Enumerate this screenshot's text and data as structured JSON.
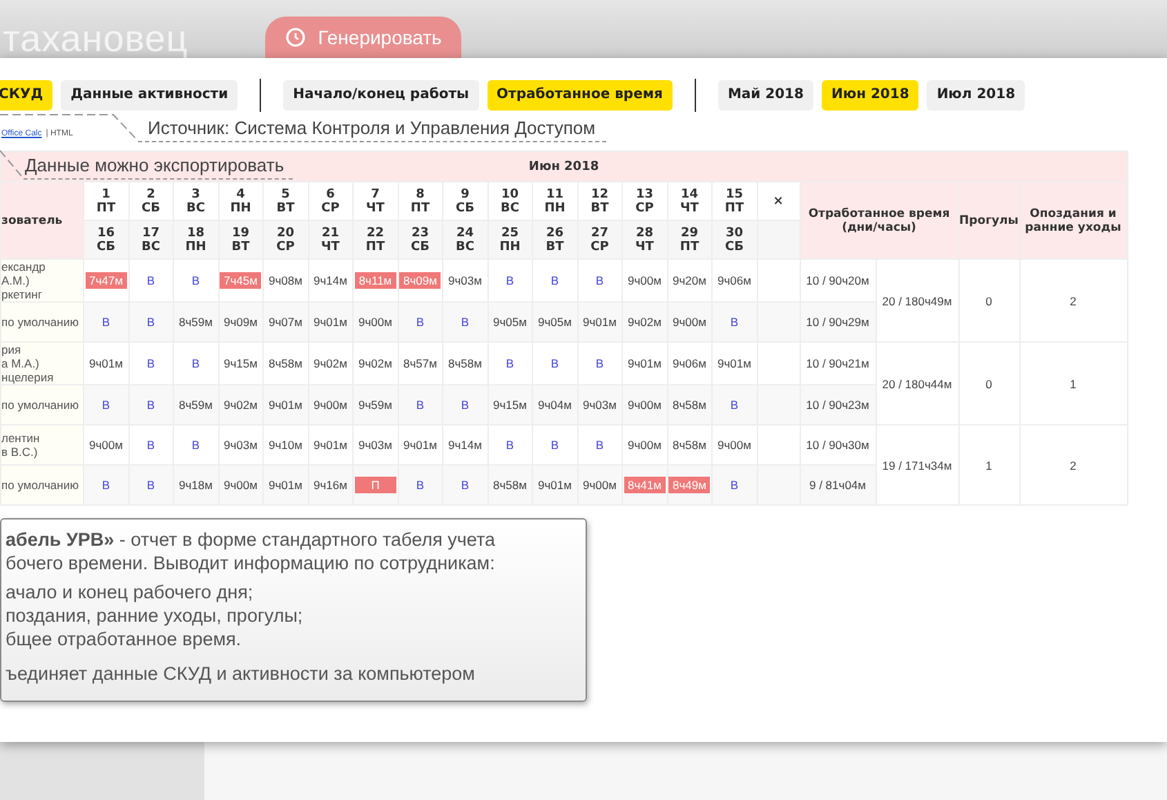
{
  "app_header": {
    "logo": "таханoвец",
    "generate_button": "Генерировать"
  },
  "toolbar": [
    [
      {
        "label": "СКУД",
        "selected": true
      },
      {
        "label": "Данные активности",
        "selected": false
      }
    ],
    [
      {
        "label": "Начало/конец работы",
        "selected": false
      },
      {
        "label": "Отработанное время",
        "selected": true
      }
    ],
    [
      {
        "label": "Май 2018",
        "selected": false
      },
      {
        "label": "Июн 2018",
        "selected": true
      },
      {
        "label": "Июл 2018",
        "selected": false
      }
    ]
  ],
  "export_links": [
    {
      "label": "Office Calc",
      "kind": "link"
    },
    {
      "label": "| HTML",
      "kind": "plain"
    }
  ],
  "annotations": [
    "Источник: Система Контроля и Управления Доступом",
    "Данные можно экспортировать"
  ],
  "table": {
    "month": "Июн 2018",
    "user_header": "зователь",
    "days_top": [
      {
        "day": "1",
        "weekday": "ПТ"
      },
      {
        "day": "2",
        "weekday": "СБ"
      },
      {
        "day": "3",
        "weekday": "ВС"
      },
      {
        "day": "4",
        "weekday": "ПН"
      },
      {
        "day": "5",
        "weekday": "ВТ"
      },
      {
        "day": "6",
        "weekday": "СР"
      },
      {
        "day": "7",
        "weekday": "ЧТ"
      },
      {
        "day": "8",
        "weekday": "ПТ"
      },
      {
        "day": "9",
        "weekday": "СБ"
      },
      {
        "day": "10",
        "weekday": "ВС"
      },
      {
        "day": "11",
        "weekday": "ПН"
      },
      {
        "day": "12",
        "weekday": "ВТ"
      },
      {
        "day": "13",
        "weekday": "СР"
      },
      {
        "day": "14",
        "weekday": "ЧТ"
      },
      {
        "day": "15",
        "weekday": "ПТ"
      }
    ],
    "days_bottom": [
      {
        "day": "16",
        "weekday": "СБ"
      },
      {
        "day": "17",
        "weekday": "ВС"
      },
      {
        "day": "18",
        "weekday": "ПН"
      },
      {
        "day": "19",
        "weekday": "ВТ"
      },
      {
        "day": "20",
        "weekday": "СР"
      },
      {
        "day": "21",
        "weekday": "ЧТ"
      },
      {
        "day": "22",
        "weekday": "ПТ"
      },
      {
        "day": "23",
        "weekday": "СБ"
      },
      {
        "day": "24",
        "weekday": "ВС"
      },
      {
        "day": "25",
        "weekday": "ПН"
      },
      {
        "day": "26",
        "weekday": "ВТ"
      },
      {
        "day": "27",
        "weekday": "СР"
      },
      {
        "day": "28",
        "weekday": "ЧТ"
      },
      {
        "day": "29",
        "weekday": "ПТ"
      },
      {
        "day": "30",
        "weekday": "СБ"
      }
    ],
    "close_header": "×",
    "worked_header": "Отработанное время (дни/часы)",
    "absences_header": "Прогулы",
    "late_header": "Опоздания и ранние уходы",
    "employees": [
      {
        "name_lines": [
          "ександр",
          "А.М.)",
          "ркетинг"
        ],
        "schedule": "по умолчанию",
        "total": "20 / 180ч49м",
        "absences": "0",
        "late": "2",
        "rows": [
          {
            "worked": "10 / 90ч20м",
            "cells": [
              {
                "text": "7ч47м",
                "kind": "flag"
              },
              {
                "text": "В",
                "kind": "day_off"
              },
              {
                "text": "В",
                "kind": "day_off"
              },
              {
                "text": "7ч45м",
                "kind": "flag"
              },
              {
                "text": "9ч08м",
                "kind": "time"
              },
              {
                "text": "9ч14м",
                "kind": "time"
              },
              {
                "text": "8ч11м",
                "kind": "flag"
              },
              {
                "text": "8ч09м",
                "kind": "flag"
              },
              {
                "text": "9ч03м",
                "kind": "time"
              },
              {
                "text": "В",
                "kind": "day_off"
              },
              {
                "text": "В",
                "kind": "day_off"
              },
              {
                "text": "В",
                "kind": "day_off"
              },
              {
                "text": "9ч00м",
                "kind": "time"
              },
              {
                "text": "9ч20м",
                "kind": "time"
              },
              {
                "text": "9ч06м",
                "kind": "time"
              }
            ]
          },
          {
            "worked": "10 / 90ч29м",
            "cells": [
              {
                "text": "В",
                "kind": "day_off"
              },
              {
                "text": "В",
                "kind": "day_off"
              },
              {
                "text": "8ч59м",
                "kind": "time"
              },
              {
                "text": "9ч09м",
                "kind": "time"
              },
              {
                "text": "9ч07м",
                "kind": "time"
              },
              {
                "text": "9ч01м",
                "kind": "time"
              },
              {
                "text": "9ч00м",
                "kind": "time"
              },
              {
                "text": "В",
                "kind": "day_off"
              },
              {
                "text": "В",
                "kind": "day_off"
              },
              {
                "text": "9ч05м",
                "kind": "time"
              },
              {
                "text": "9ч05м",
                "kind": "time"
              },
              {
                "text": "9ч01м",
                "kind": "time"
              },
              {
                "text": "9ч02м",
                "kind": "time"
              },
              {
                "text": "9ч00м",
                "kind": "time"
              },
              {
                "text": "В",
                "kind": "day_off"
              }
            ]
          }
        ]
      },
      {
        "name_lines": [
          "рия",
          "а М.А.)",
          "нцелерия"
        ],
        "schedule": "по умолчанию",
        "total": "20 / 180ч44м",
        "absences": "0",
        "late": "1",
        "rows": [
          {
            "worked": "10 / 90ч21м",
            "cells": [
              {
                "text": "9ч01м",
                "kind": "time"
              },
              {
                "text": "В",
                "kind": "day_off"
              },
              {
                "text": "В",
                "kind": "day_off"
              },
              {
                "text": "9ч15м",
                "kind": "time"
              },
              {
                "text": "8ч58м",
                "kind": "time"
              },
              {
                "text": "9ч02м",
                "kind": "time"
              },
              {
                "text": "9ч02м",
                "kind": "time"
              },
              {
                "text": "8ч57м",
                "kind": "time"
              },
              {
                "text": "8ч58м",
                "kind": "time"
              },
              {
                "text": "В",
                "kind": "day_off"
              },
              {
                "text": "В",
                "kind": "day_off"
              },
              {
                "text": "В",
                "kind": "day_off"
              },
              {
                "text": "9ч01м",
                "kind": "time"
              },
              {
                "text": "9ч06м",
                "kind": "time"
              },
              {
                "text": "9ч01м",
                "kind": "time"
              }
            ]
          },
          {
            "worked": "10 / 90ч23м",
            "cells": [
              {
                "text": "В",
                "kind": "day_off"
              },
              {
                "text": "В",
                "kind": "day_off"
              },
              {
                "text": "8ч59м",
                "kind": "time"
              },
              {
                "text": "9ч02м",
                "kind": "time"
              },
              {
                "text": "9ч01м",
                "kind": "time"
              },
              {
                "text": "9ч00м",
                "kind": "time"
              },
              {
                "text": "9ч59м",
                "kind": "time"
              },
              {
                "text": "В",
                "kind": "day_off"
              },
              {
                "text": "В",
                "kind": "day_off"
              },
              {
                "text": "9ч15м",
                "kind": "time"
              },
              {
                "text": "9ч04м",
                "kind": "time"
              },
              {
                "text": "9ч03м",
                "kind": "time"
              },
              {
                "text": "9ч00м",
                "kind": "time"
              },
              {
                "text": "8ч58м",
                "kind": "time"
              },
              {
                "text": "В",
                "kind": "day_off"
              }
            ]
          }
        ]
      },
      {
        "name_lines": [
          "лентин",
          "в В.С.)"
        ],
        "schedule": "по умолчанию",
        "total": "19 / 171ч34м",
        "absences": "1",
        "late": "2",
        "rows": [
          {
            "worked": "10 / 90ч30м",
            "cells": [
              {
                "text": "9ч00м",
                "kind": "time"
              },
              {
                "text": "В",
                "kind": "day_off"
              },
              {
                "text": "В",
                "kind": "day_off"
              },
              {
                "text": "9ч03м",
                "kind": "time"
              },
              {
                "text": "9ч10м",
                "kind": "time"
              },
              {
                "text": "9ч01м",
                "kind": "time"
              },
              {
                "text": "9ч03м",
                "kind": "time"
              },
              {
                "text": "9ч01м",
                "kind": "time"
              },
              {
                "text": "9ч14м",
                "kind": "time"
              },
              {
                "text": "В",
                "kind": "day_off"
              },
              {
                "text": "В",
                "kind": "day_off"
              },
              {
                "text": "В",
                "kind": "day_off"
              },
              {
                "text": "9ч00м",
                "kind": "time"
              },
              {
                "text": "8ч58м",
                "kind": "time"
              },
              {
                "text": "9ч00м",
                "kind": "time"
              }
            ]
          },
          {
            "worked": "9 / 81ч04м",
            "cells": [
              {
                "text": "В",
                "kind": "day_off"
              },
              {
                "text": "В",
                "kind": "day_off"
              },
              {
                "text": "9ч18м",
                "kind": "time"
              },
              {
                "text": "9ч00м",
                "kind": "time"
              },
              {
                "text": "9ч01м",
                "kind": "time"
              },
              {
                "text": "9ч16м",
                "kind": "time"
              },
              {
                "text": "П",
                "kind": "flag"
              },
              {
                "text": "В",
                "kind": "day_off"
              },
              {
                "text": "В",
                "kind": "day_off"
              },
              {
                "text": "8ч58м",
                "kind": "time"
              },
              {
                "text": "9ч01м",
                "kind": "time"
              },
              {
                "text": "9ч00м",
                "kind": "time"
              },
              {
                "text": "8ч41м",
                "kind": "flag"
              },
              {
                "text": "8ч49м",
                "kind": "flag"
              },
              {
                "text": "В",
                "kind": "day_off"
              }
            ]
          }
        ]
      }
    ]
  },
  "callout": {
    "intro_lines": [
      "**абель УРВ»** - отчет в форме стандартного табеля учета",
      "бочего времени. Выводит информацию по сотрудникам:"
    ],
    "items": [
      "ачало и конец рабочего дня;",
      "поздания, ранние уходы, прогулы;",
      "бщее отработанное время."
    ],
    "footer": "ъединяет данные СКУД и активности за компьютером"
  }
}
